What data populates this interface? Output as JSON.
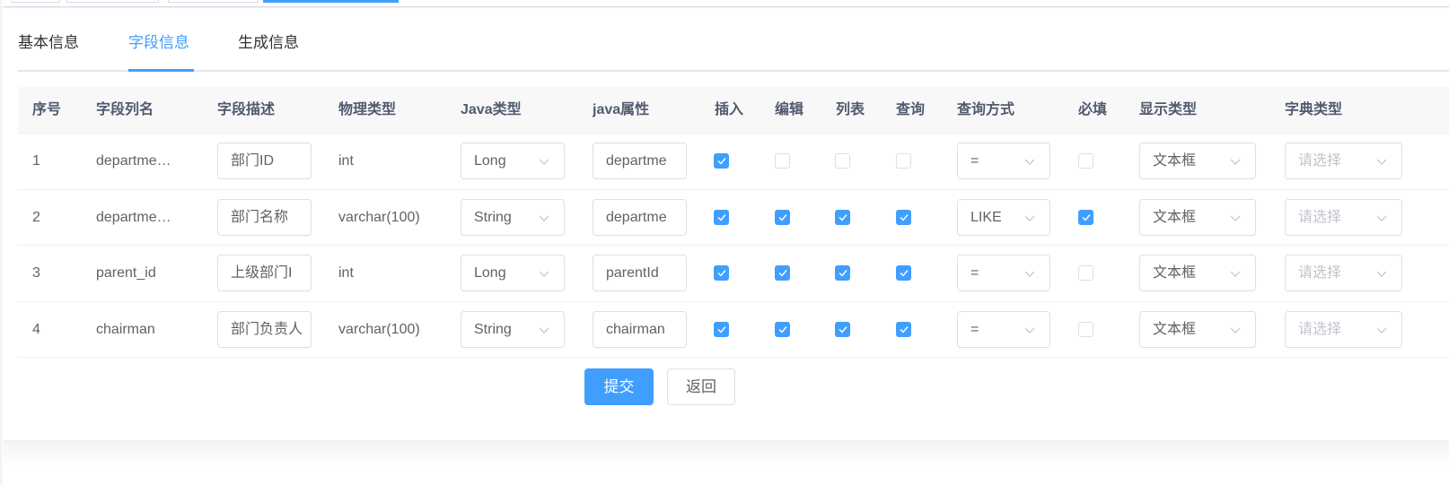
{
  "top_tags": [
    {
      "label": "",
      "active": false
    },
    {
      "label": "",
      "active": false
    },
    {
      "label": "",
      "active": false
    },
    {
      "label": "",
      "active": true
    }
  ],
  "tabs": [
    {
      "label": "基本信息",
      "active": false
    },
    {
      "label": "字段信息",
      "active": true
    },
    {
      "label": "生成信息",
      "active": false
    }
  ],
  "table": {
    "headers": {
      "index": "序号",
      "column_name": "字段列名",
      "column_desc": "字段描述",
      "physical_type": "物理类型",
      "java_type": "Java类型",
      "java_field": "java属性",
      "insert": "插入",
      "edit": "编辑",
      "list": "列表",
      "query": "查询",
      "query_type": "查询方式",
      "required": "必填",
      "html_type": "显示类型",
      "dict_type": "字典类型"
    },
    "rows": [
      {
        "index": "1",
        "column_name": "departme…",
        "column_desc": "部门ID",
        "physical_type": "int",
        "java_type": "Long",
        "java_field": "departme",
        "insert": true,
        "edit": false,
        "list": false,
        "query": false,
        "query_type": "=",
        "required": false,
        "html_type": "文本框",
        "dict_type_placeholder": "请选择"
      },
      {
        "index": "2",
        "column_name": "departme…",
        "column_desc": "部门名称",
        "physical_type": "varchar(100)",
        "java_type": "String",
        "java_field": "departme",
        "insert": true,
        "edit": true,
        "list": true,
        "query": true,
        "query_type": "LIKE",
        "required": true,
        "html_type": "文本框",
        "dict_type_placeholder": "请选择"
      },
      {
        "index": "3",
        "column_name": "parent_id",
        "column_desc": "上级部门I",
        "physical_type": "int",
        "java_type": "Long",
        "java_field": "parentId",
        "insert": true,
        "edit": true,
        "list": true,
        "query": true,
        "query_type": "=",
        "required": false,
        "html_type": "文本框",
        "dict_type_placeholder": "请选择"
      },
      {
        "index": "4",
        "column_name": "chairman",
        "column_desc": "部门负责人",
        "physical_type": "varchar(100)",
        "java_type": "String",
        "java_field": "chairman",
        "insert": true,
        "edit": true,
        "list": true,
        "query": true,
        "query_type": "=",
        "required": false,
        "html_type": "文本框",
        "dict_type_placeholder": "请选择"
      }
    ]
  },
  "buttons": {
    "submit": "提交",
    "back": "返回"
  },
  "colors": {
    "primary": "#409eff",
    "header_bg": "#f8f8f9",
    "border": "#dcdfe6",
    "text": "#606266",
    "placeholder": "#c0c4cc"
  }
}
